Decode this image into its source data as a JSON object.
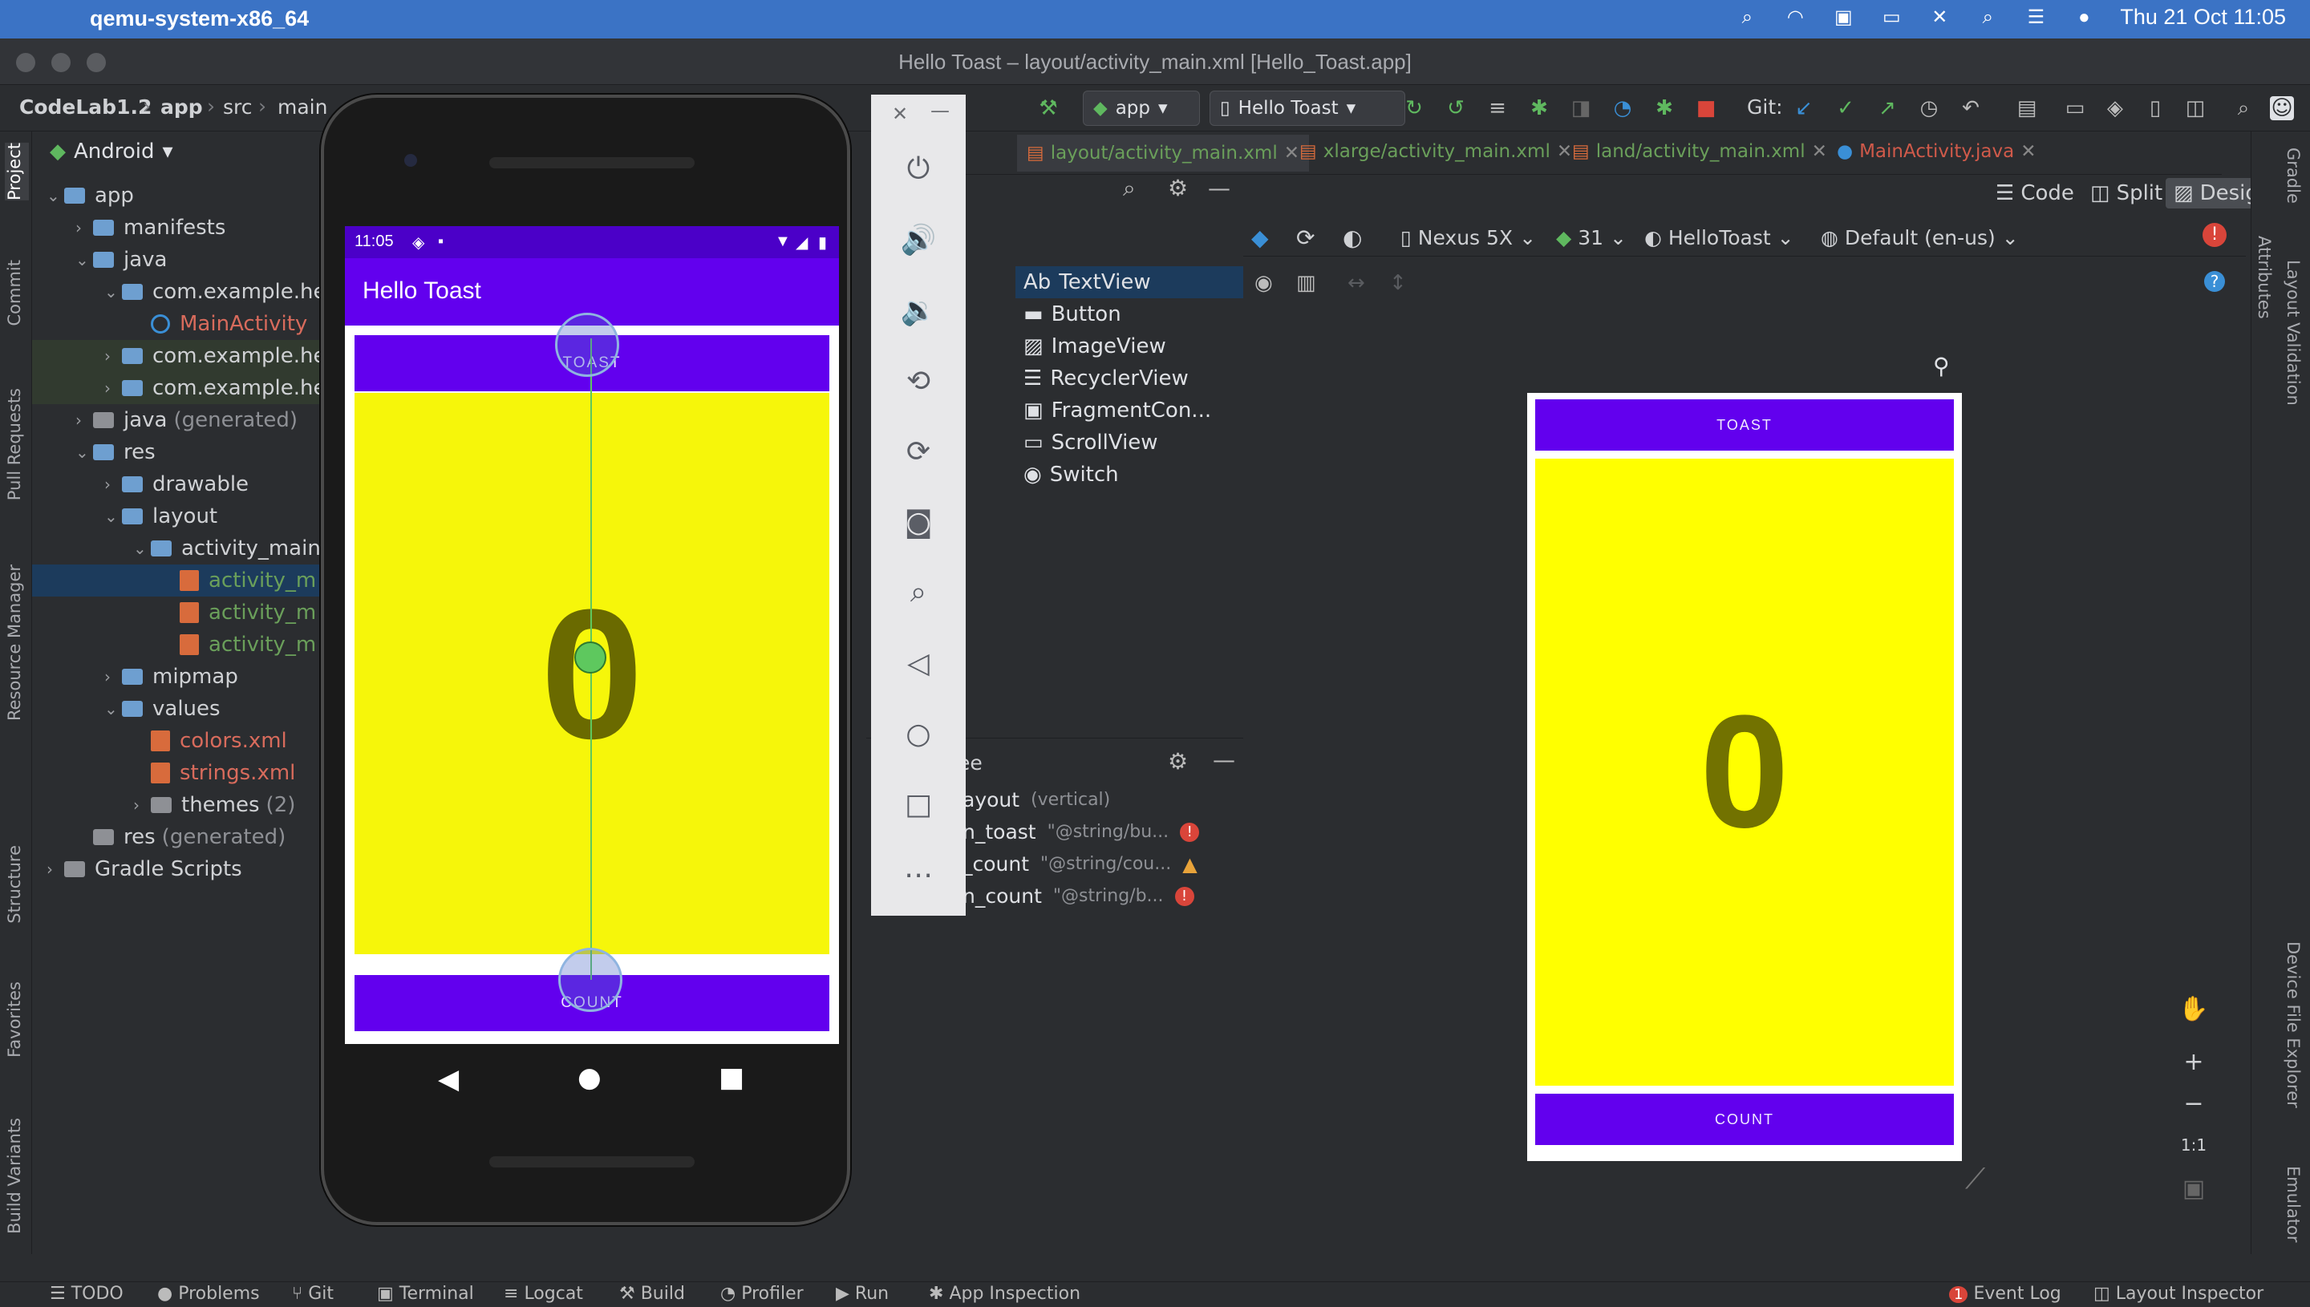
{
  "menubar": {
    "app": "qemu-system-x86_64",
    "clock": "Thu 21 Oct  11:05"
  },
  "window": {
    "title": "Hello Toast – layout/activity_main.xml [Hello_Toast.app]"
  },
  "toolbar": {
    "breadcrumbs": [
      "CodeLab1.2",
      "app",
      "src",
      "main"
    ],
    "run_config": "app",
    "device": "Hello Toast",
    "git_label": "Git:"
  },
  "project": {
    "view": "Android",
    "tree": [
      {
        "label": "app",
        "depth": 0,
        "open": true,
        "kind": "folder"
      },
      {
        "label": "manifests",
        "depth": 1,
        "open": false,
        "kind": "folder"
      },
      {
        "label": "java",
        "depth": 1,
        "open": true,
        "kind": "folder"
      },
      {
        "label": "com.example.he",
        "depth": 2,
        "open": true,
        "kind": "folder"
      },
      {
        "label": "MainActivity",
        "depth": 3,
        "kind": "class"
      },
      {
        "label": "com.example.he",
        "depth": 2,
        "open": false,
        "kind": "folder"
      },
      {
        "label": "com.example.he",
        "depth": 2,
        "open": false,
        "kind": "folder"
      },
      {
        "label": "java",
        "suffix": "(generated)",
        "depth": 1,
        "open": false,
        "kind": "folder"
      },
      {
        "label": "res",
        "depth": 1,
        "open": true,
        "kind": "folder"
      },
      {
        "label": "drawable",
        "depth": 2,
        "open": false,
        "kind": "folder"
      },
      {
        "label": "layout",
        "depth": 2,
        "open": true,
        "kind": "folder"
      },
      {
        "label": "activity_main",
        "depth": 3,
        "open": true,
        "kind": "folder"
      },
      {
        "label": "activity_m",
        "depth": 4,
        "kind": "xml"
      },
      {
        "label": "activity_m",
        "depth": 4,
        "kind": "xml"
      },
      {
        "label": "activity_m",
        "depth": 4,
        "kind": "xml"
      },
      {
        "label": "mipmap",
        "depth": 2,
        "open": false,
        "kind": "folder"
      },
      {
        "label": "values",
        "depth": 2,
        "open": true,
        "kind": "folder"
      },
      {
        "label": "colors.xml",
        "depth": 3,
        "kind": "xmlred"
      },
      {
        "label": "strings.xml",
        "depth": 3,
        "kind": "xmlred"
      },
      {
        "label": "themes",
        "suffix": "(2)",
        "depth": 3,
        "open": false,
        "kind": "folder"
      },
      {
        "label": "res",
        "suffix": "(generated)",
        "depth": 1,
        "kind": "folder"
      },
      {
        "label": "Gradle Scripts",
        "depth": 0,
        "open": false,
        "kind": "gradle"
      }
    ]
  },
  "left_tabs": [
    "Project",
    "Commit",
    "Pull Requests",
    "Resource Manager",
    "Structure",
    "Favorites",
    "Build Variants"
  ],
  "right_tabs": [
    "Gradle",
    "Attributes",
    "Layout Validation",
    "Device File Explorer",
    "Emulator"
  ],
  "editor_tabs": [
    {
      "label": "layout/activity_main.xml",
      "color": "#6a9f5a"
    },
    {
      "label": "xlarge/activity_main.xml",
      "color": "#6a9f5a"
    },
    {
      "label": "land/activity_main.xml",
      "color": "#6a9f5a"
    },
    {
      "label": "MainActivity.java",
      "color": "#d05a4a"
    }
  ],
  "modes": {
    "code": "Code",
    "split": "Split",
    "design": "Design"
  },
  "design_toolbar": {
    "device": "Nexus 5X",
    "api": "31",
    "theme": "HelloToast",
    "locale": "Default (en-us)"
  },
  "palette": [
    "TextView",
    "Button",
    "ImageView",
    "RecyclerView",
    "FragmentCon...",
    "ScrollView",
    "Switch"
  ],
  "palette_ab": "Ab",
  "component_tree": {
    "header": "ee",
    "rows": [
      {
        "name": "ayout",
        "value": "(vertical)",
        "status": ""
      },
      {
        "name": "n_toast",
        "value": "\"@string/bu...",
        "status": "error"
      },
      {
        "name": "_count",
        "value": "\"@string/cou...",
        "status": "warning"
      },
      {
        "name": "n_count",
        "value": "\"@string/b...",
        "status": "error"
      }
    ]
  },
  "phone": {
    "time": "11:05",
    "app_title": "Hello Toast",
    "toast_button": "TOAST",
    "count_button": "COUNT",
    "count_value": "0"
  },
  "preview": {
    "toast_button": "TOAST",
    "count_button": "COUNT",
    "count_value": "0"
  },
  "zoom": {
    "one_to_one": "1:1"
  },
  "bottom_tabs": [
    "TODO",
    "Problems",
    "Git",
    "Terminal",
    "Logcat",
    "Build",
    "Profiler",
    "Run",
    "App Inspection"
  ],
  "bottom_right": [
    "Event Log",
    "Layout Inspector"
  ],
  "event_badge": "1",
  "colors": {
    "primary": "#6200ee",
    "yellow": "#ffff00",
    "menubar": "#3b73c5"
  }
}
